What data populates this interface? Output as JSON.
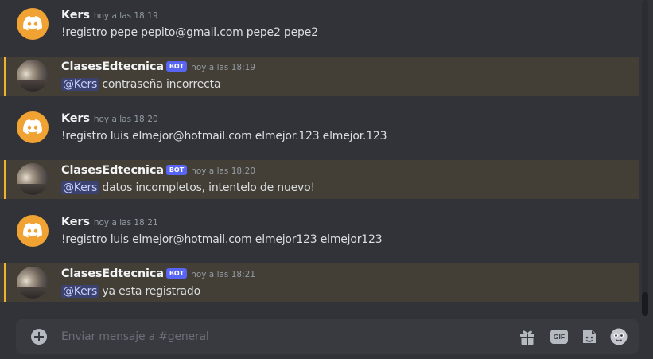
{
  "colors": {
    "background": "#313338",
    "mention_highlight": "#433f37",
    "mention_bar": "#f0b232",
    "bot_tag": "#5865f2",
    "discord_avatar": "#f0a232"
  },
  "messages": [
    {
      "username": "Kers",
      "timestamp": "hoy a las 18:19",
      "text": "!registro pepe pepito@gmail.com pepe2 pepe2",
      "avatar": "discord-logo-icon"
    },
    {
      "username": "ClasesEdtecnica",
      "bot_tag": "BOT",
      "timestamp": "hoy a las 18:19",
      "mention": "@Kers",
      "text": " contraseña incorrecta",
      "avatar": "photo"
    },
    {
      "username": "Kers",
      "timestamp": "hoy a las 18:20",
      "text": "!registro luis elmejor@hotmail.com elmejor.123 elmejor.123",
      "avatar": "discord-logo-icon"
    },
    {
      "username": "ClasesEdtecnica",
      "bot_tag": "BOT",
      "timestamp": "hoy a las 18:20",
      "mention": "@Kers",
      "text": " datos incompletos, intentelo de nuevo!",
      "avatar": "photo"
    },
    {
      "username": "Kers",
      "timestamp": "hoy a las 18:21",
      "text": "!registro luis elmejor@hotmail.com elmejor123 elmejor123",
      "avatar": "discord-logo-icon"
    },
    {
      "username": "ClasesEdtecnica",
      "bot_tag": "BOT",
      "timestamp": "hoy a las 18:21",
      "mention": "@Kers",
      "text": " ya esta registrado",
      "avatar": "photo"
    }
  ],
  "composer": {
    "placeholder": "Enviar mensaje a #general",
    "value": "",
    "icons": [
      "plus-circle-icon",
      "gift-icon",
      "gif-icon",
      "sticker-icon",
      "emoji-icon"
    ],
    "gif_label": "GIF"
  }
}
